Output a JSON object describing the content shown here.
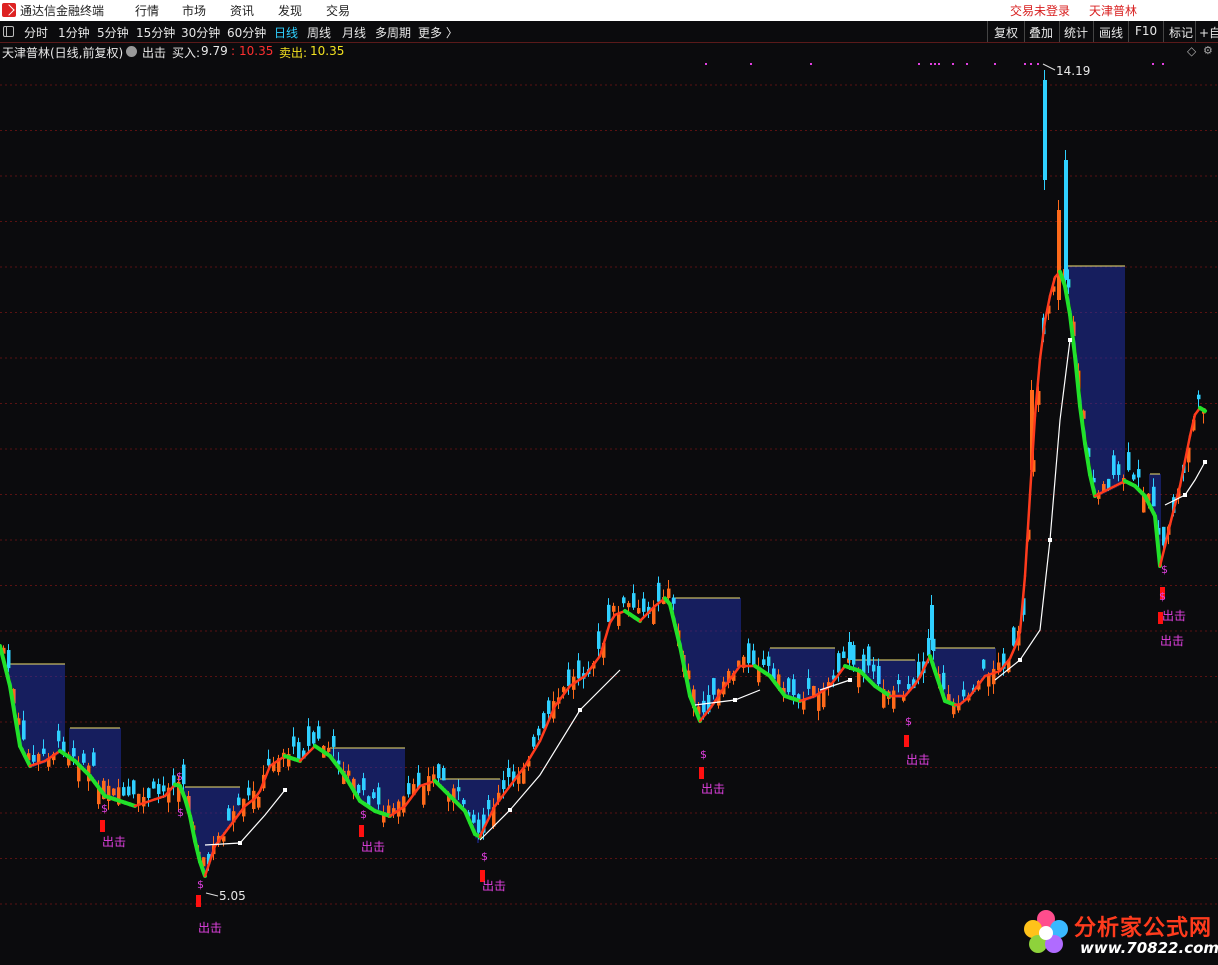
{
  "app": {
    "name": "通达信金融终端",
    "menu": [
      "行情",
      "市场",
      "资讯",
      "发现",
      "交易"
    ],
    "login_status": "交易未登录",
    "stock_name_top": "天津普林"
  },
  "toolbar": {
    "periods": [
      "分时",
      "1分钟",
      "5分钟",
      "15分钟",
      "30分钟",
      "60分钟",
      "日线",
      "周线",
      "月线",
      "多周期",
      "更多 〉"
    ],
    "active_period": "日线",
    "right_buttons": [
      "复权",
      "叠加",
      "统计",
      "画线",
      "F10",
      "标记",
      "+自"
    ]
  },
  "info": {
    "title": "天津普林(日线,前复权)",
    "indicator": "出击",
    "buy_label": "买入:",
    "buy_value1": "9.79",
    "buy_sep": ":",
    "buy_value2": "10.35",
    "sell_label": "卖出:",
    "sell_value": "10.35"
  },
  "chart_data": {
    "type": "candlestick",
    "high_label": "14.19",
    "low_label": "5.05",
    "signal_label": "出击",
    "signal_symbol": "$",
    "colors": {
      "up": "#ff6a1a",
      "down": "#2fd0ff",
      "ma_up": "#ff3b1d",
      "ma_down": "#22e02a",
      "band": "#2030b0",
      "slow_line": "#ffffff",
      "signal": "#e040e0",
      "signal_bar": "#ff1010"
    }
  },
  "watermark": {
    "title": "分析家公式网",
    "url": "www.70822.com"
  }
}
